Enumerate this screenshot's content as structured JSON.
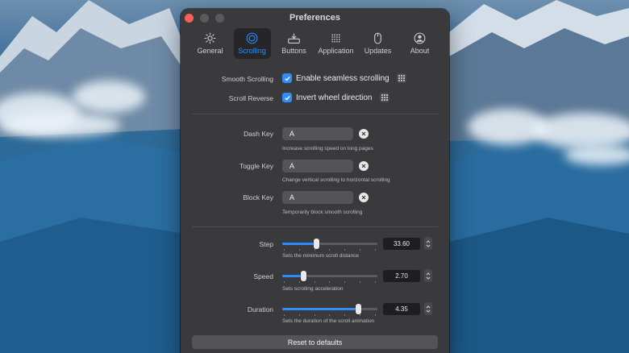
{
  "window": {
    "title": "Preferences"
  },
  "toolbar": {
    "tabs": [
      {
        "label": "General",
        "icon": "gear-icon"
      },
      {
        "label": "Scrolling",
        "icon": "scroll-wheel-icon",
        "active": true
      },
      {
        "label": "Buttons",
        "icon": "tray-arrow-icon"
      },
      {
        "label": "Application",
        "icon": "grid-dots-icon"
      },
      {
        "label": "Updates",
        "icon": "mouse-icon"
      },
      {
        "label": "About",
        "icon": "person-circle-icon"
      }
    ]
  },
  "scrolling": {
    "smooth_label": "Smooth Scrolling",
    "smooth_check": "Enable seamless scrolling",
    "smooth_checked": true,
    "reverse_label": "Scroll Reverse",
    "reverse_check": "Invert wheel direction",
    "reverse_checked": true
  },
  "keys": {
    "dash": {
      "label": "Dash Key",
      "value": "A",
      "hint": "Increase scrolling speed on long pages"
    },
    "toggle": {
      "label": "Toggle Key",
      "value": "A",
      "hint": "Change vertical scrolling to horizontal scrolling"
    },
    "block": {
      "label": "Block Key",
      "value": "A",
      "hint": "Temporarily block smooth scrolling"
    }
  },
  "sliders": {
    "step": {
      "label": "Step",
      "value": "33.60",
      "fraction": 0.35,
      "hint": "Sets the minimum scroll distance"
    },
    "speed": {
      "label": "Speed",
      "value": "2.70",
      "fraction": 0.21,
      "hint": "Sets scrolling acceleration"
    },
    "duration": {
      "label": "Duration",
      "value": "4.35",
      "fraction": 0.82,
      "hint": "Sets the duration of the scroll animation"
    }
  },
  "reset_label": "Reset to defaults",
  "colors": {
    "accent": "#2f8cff",
    "window_bg": "#3a3a3c",
    "close": "#ff5f57"
  }
}
